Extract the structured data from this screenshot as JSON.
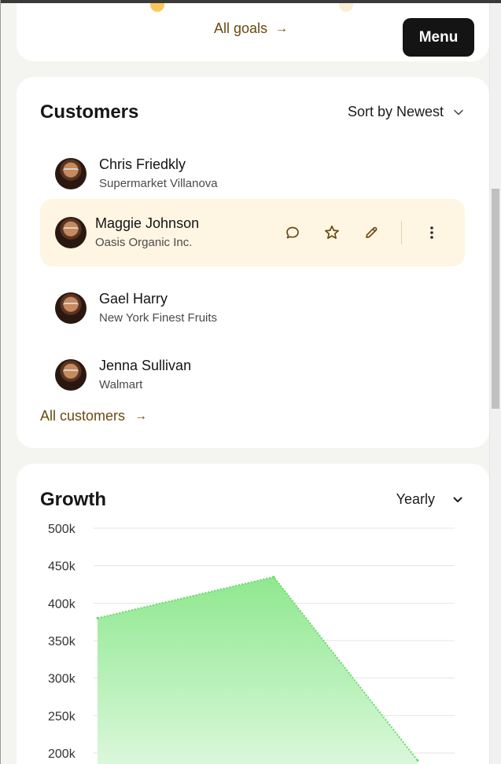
{
  "menu": {
    "label": "Menu"
  },
  "goals": {
    "link_label": "All goals",
    "arrow_icon": "arrow-right-icon"
  },
  "customers": {
    "title": "Customers",
    "sort_label": "Sort by Newest",
    "list": [
      {
        "name": "Chris Friedkly",
        "company": "Supermarket Villanova",
        "active": false
      },
      {
        "name": "Maggie Johnson",
        "company": "Oasis Organic Inc.",
        "active": true
      },
      {
        "name": "Gael Harry",
        "company": "New York Finest Fruits",
        "active": false
      },
      {
        "name": "Jenna Sullivan",
        "company": "Walmart",
        "active": false
      }
    ],
    "row_actions": [
      "chat-bubble-icon",
      "star-icon",
      "pencil-icon",
      "more-vertical-icon"
    ],
    "all_label": "All customers"
  },
  "growth": {
    "title": "Growth",
    "period_label": "Yearly"
  },
  "chart_data": {
    "type": "area",
    "title": "Growth",
    "xlabel": "",
    "ylabel": "",
    "yticks": [
      "500k",
      "450k",
      "400k",
      "350k",
      "300k",
      "250k",
      "200k"
    ],
    "ylim": [
      200000,
      500000
    ],
    "grid": true,
    "series": [
      {
        "values": [
          380000,
          435000,
          190000
        ]
      }
    ],
    "colors": {
      "fill_top": "#8fe88f",
      "fill_bottom": "#e6fae6",
      "edge": "#6bd96b"
    }
  },
  "colors": {
    "accent_link": "#6b4a0e",
    "active_row": "#fef5e3",
    "menu_bg": "#141414",
    "page_bg": "#f4f4f0"
  }
}
